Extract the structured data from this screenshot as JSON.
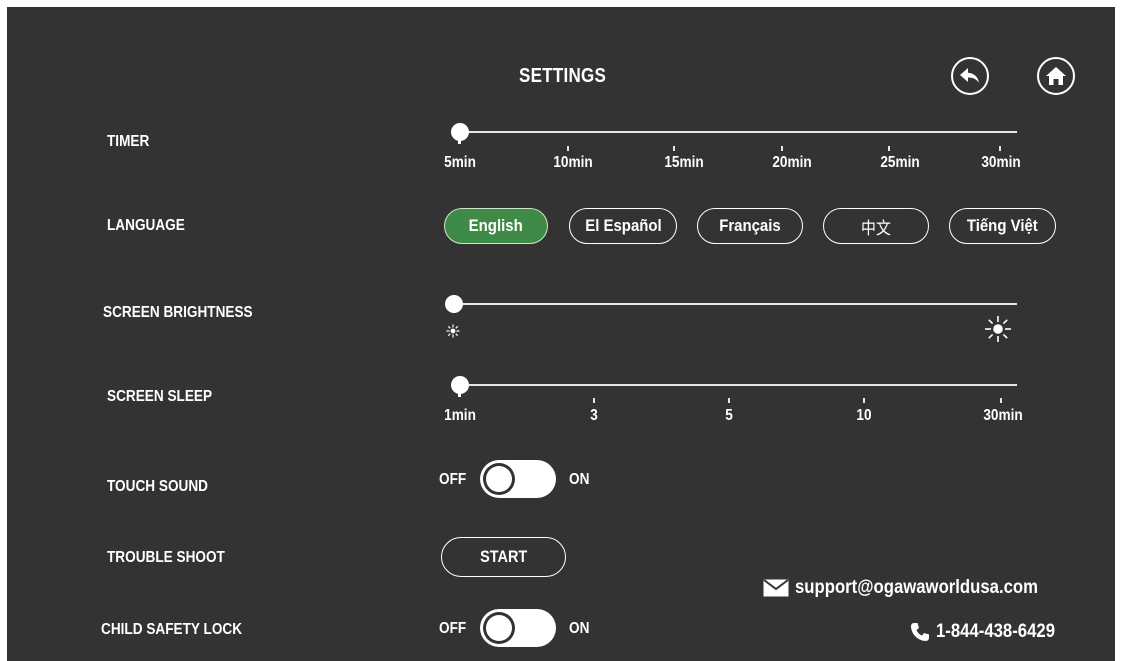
{
  "header": {
    "title": "SETTINGS",
    "back_icon": "back-arrow-icon",
    "home_icon": "home-icon"
  },
  "timer": {
    "label": "TIMER",
    "ticks": [
      "5min",
      "10min",
      "15min",
      "20min",
      "25min",
      "30min"
    ],
    "selected": "5min"
  },
  "language": {
    "label": "LANGUAGE",
    "options": [
      "English",
      "El Español",
      "Français",
      "中文",
      "Tiếng Việt"
    ],
    "selected": "English"
  },
  "brightness": {
    "label": "SCREEN BRIGHTNESS",
    "level": 0,
    "min_icon": "dim-sun-icon",
    "max_icon": "bright-sun-icon"
  },
  "screen_sleep": {
    "label": "SCREEN SLEEP",
    "ticks": [
      "1min",
      "3",
      "5",
      "10",
      "30min"
    ],
    "selected": "1min"
  },
  "touch_sound": {
    "label": "TOUCH SOUND",
    "off_label": "OFF",
    "on_label": "ON",
    "state": "OFF"
  },
  "trouble_shoot": {
    "label": "TROUBLE SHOOT",
    "button_label": "START"
  },
  "child_lock": {
    "label": "CHILD SAFETY LOCK",
    "off_label": "OFF",
    "on_label": "ON",
    "state": "OFF"
  },
  "contact": {
    "email": "support@ogawaworldusa.com",
    "phone": "1-844-438-6429",
    "email_icon": "envelope-icon",
    "phone_icon": "phone-icon"
  },
  "colors": {
    "background": "#333333",
    "accent": "#3f8a46",
    "foreground": "#ffffff"
  }
}
